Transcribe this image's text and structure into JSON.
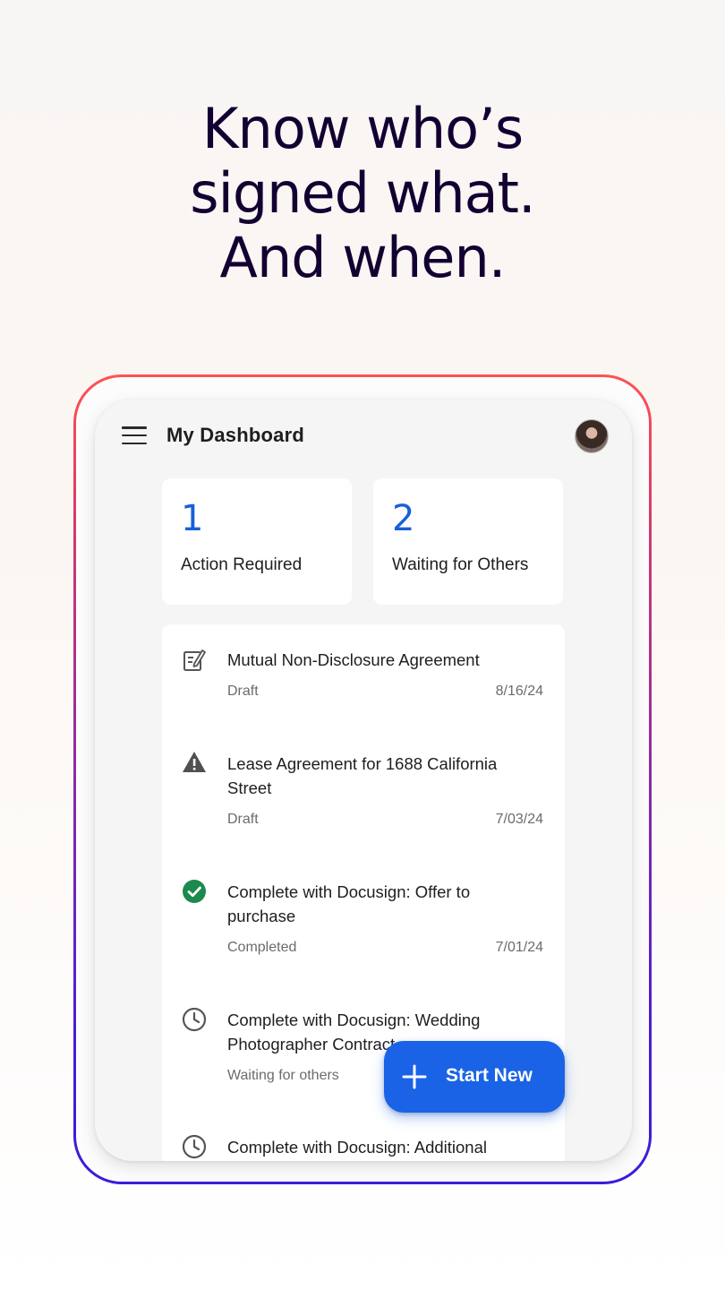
{
  "headline": {
    "line1": "Know who’s",
    "line2": "signed what.",
    "line3": "And when."
  },
  "app": {
    "title": "My Dashboard",
    "menu_icon": "hamburger-menu-icon",
    "avatar_icon": "user-avatar"
  },
  "stats": [
    {
      "count": "1",
      "label": "Action Required"
    },
    {
      "count": "2",
      "label": "Waiting for Others"
    }
  ],
  "documents": [
    {
      "icon": "edit-document-icon",
      "name": "Mutual Non-Disclosure Agreement",
      "status": "Draft",
      "date": "8/16/24"
    },
    {
      "icon": "warning-icon",
      "name": "Lease Agreement for 1688 California Street",
      "status": "Draft",
      "date": "7/03/24"
    },
    {
      "icon": "check-circle-icon",
      "name": "Complete with Docusign: Offer to purchase",
      "status": "Completed",
      "date": "7/01/24"
    },
    {
      "icon": "clock-icon",
      "name": "Complete with Docusign: Wedding Photographer Contract",
      "status": "Waiting for others",
      "date": ""
    },
    {
      "icon": "clock-icon",
      "name": "Complete with Docusign: Additional",
      "status": "",
      "date": ""
    }
  ],
  "fab": {
    "label": "Start New",
    "icon": "plus-icon"
  },
  "colors": {
    "accent_blue": "#1a63e6",
    "complete_green": "#1b8a4c",
    "headline_ink": "#130032"
  }
}
